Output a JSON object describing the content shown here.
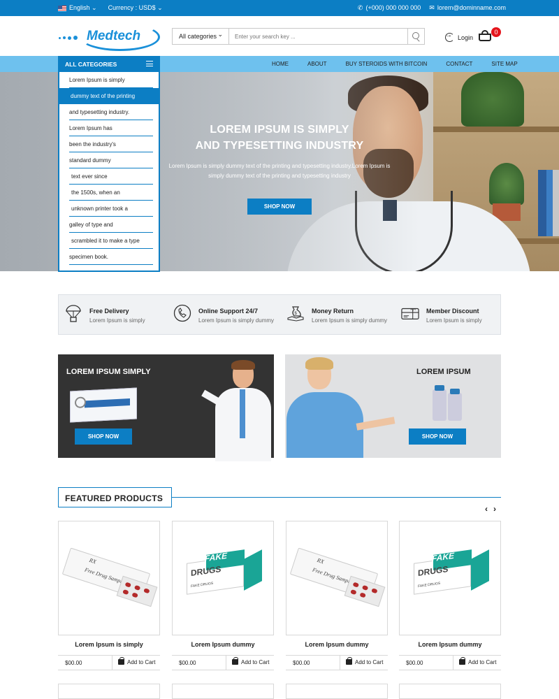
{
  "topbar": {
    "language": "English",
    "currency": "Currency : USD$",
    "phone": "(+000) 000 000 000",
    "email": "lorem@dominname.com"
  },
  "header": {
    "logo_text": "Medtech",
    "search_category": "All categories",
    "search_placeholder": "Enter your search key ...",
    "login_label": "Login",
    "cart_count": "0"
  },
  "nav": {
    "categories_label": "ALL CATEGORIES",
    "links": [
      "HOME",
      "ABOUT",
      "BUY STEROIDS WITH BITCOIN",
      "CONTACT",
      "SITE MAP"
    ]
  },
  "categories": [
    "Lorem Ipsum is simply",
    "dummy text of the printing",
    "and typesetting industry.",
    "Lorem Ipsum has",
    "been the industry's",
    "standard dummy",
    "text ever since",
    "the 1500s, when an",
    "unknown printer took a",
    "galley of type and",
    "scrambled it to make a type",
    "specimen book."
  ],
  "hero": {
    "title_line1": "LOREM IPSUM IS SIMPLY",
    "title_line2": "AND TYPESETTING INDUSTRY",
    "subtitle": "Lorem Ipsum is simply dummy text of the printing and typesetting industry.Lorem Ipsum is simply dummy text of the printing and typesetting industry",
    "button": "SHOP NOW"
  },
  "features": [
    {
      "title": "Free Delivery",
      "text": "Lorem Ipsum is simply",
      "icon": "parachute-box-icon"
    },
    {
      "title": "Online Support 24/7",
      "text": "Lorem Ipsum is simply dummy",
      "icon": "phone-icon"
    },
    {
      "title": "Money Return",
      "text": "Lorem Ipsum is simply dummy",
      "icon": "money-bag-icon"
    },
    {
      "title": "Member Discount",
      "text": "Lorem Ipsum is simply",
      "icon": "gift-card-icon"
    }
  ],
  "banners": [
    {
      "title": "LOREM IPSUM SIMPLY",
      "button": "SHOP NOW"
    },
    {
      "title": "LOREM IPSUM",
      "button": "SHOP NOW"
    }
  ],
  "featured": {
    "heading": "FEATURED PRODUCTS",
    "prev": "‹",
    "next": "›",
    "products": [
      {
        "name": "Lorem Ipsum is simply",
        "price": "$00.00",
        "cta": "Add to Cart",
        "image": "free-drug-sample"
      },
      {
        "name": "Lorem Ipsum dummy",
        "price": "$00.00",
        "cta": "Add to Cart",
        "image": "fake-drugs"
      },
      {
        "name": "Lorem Ipsum dummy",
        "price": "$00.00",
        "cta": "Add to Cart",
        "image": "free-drug-sample"
      },
      {
        "name": "Lorem Ipsum dummy",
        "price": "$00.00",
        "cta": "Add to Cart",
        "image": "fake-drugs"
      }
    ],
    "box_text": {
      "rx": "RX",
      "sample": "Free Drug Sample",
      "fake": "FAKE",
      "drugs": "DRUGS",
      "fake_small": "FAKE DRUGS"
    }
  },
  "colors": {
    "primary": "#0c7ec4",
    "nav": "#6ec1ee",
    "badge": "#e5141b"
  }
}
